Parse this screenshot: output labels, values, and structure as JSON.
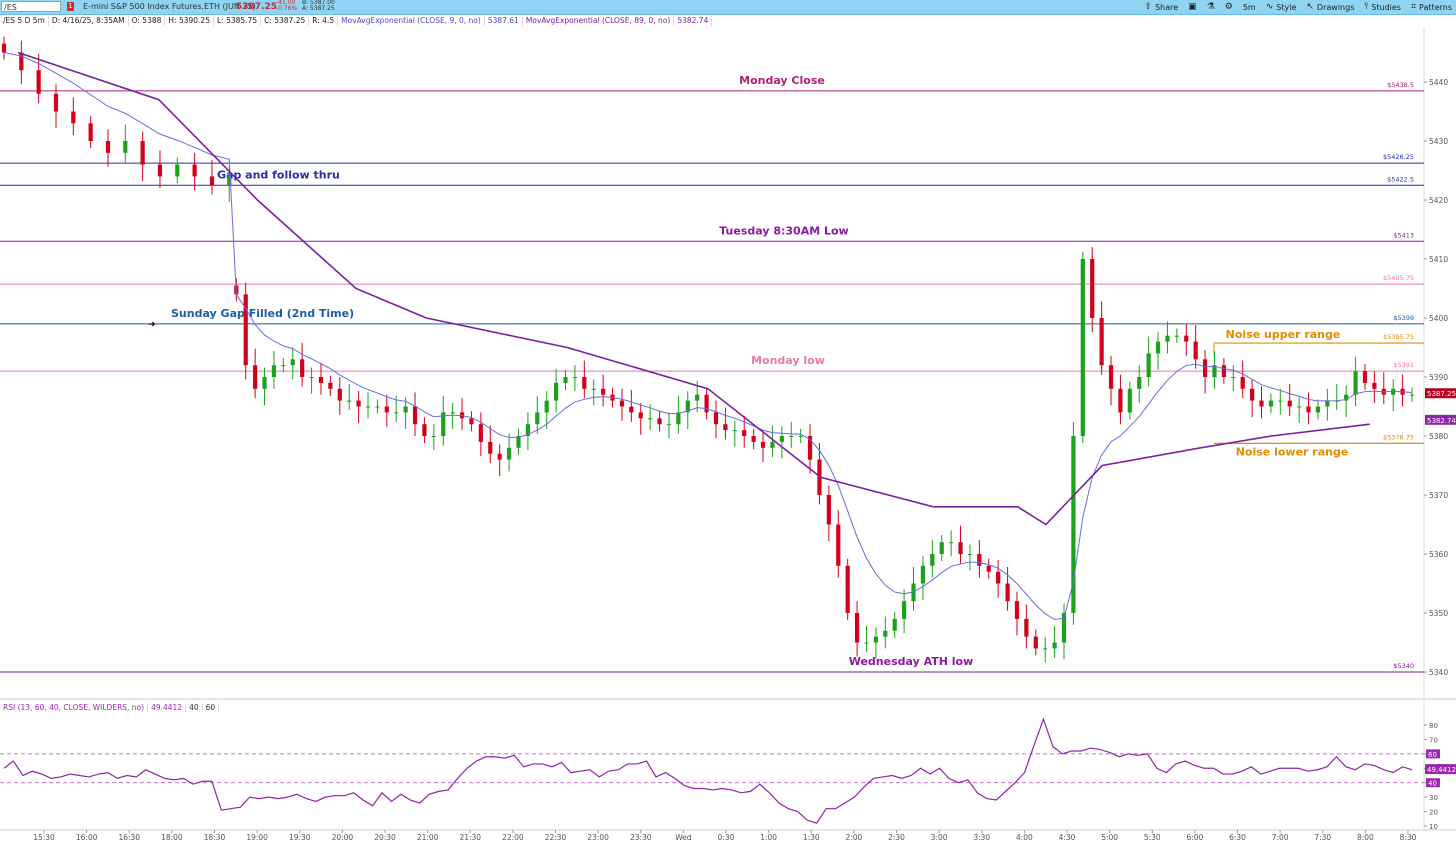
{
  "header": {
    "symbol": "/ES",
    "flag": "1",
    "description": "E-mini S&P 500 Index Futures,ETH (JUN 25)",
    "last": "5387.25",
    "change": "-41.00",
    "change_pct": "-0.76%",
    "bid": "B: 5387.00",
    "ask": "A: 5387.25"
  },
  "toolbar": [
    {
      "icon": "share-icon",
      "glyph": "⇪",
      "label": "Share"
    },
    {
      "icon": "camera-icon",
      "glyph": "▣",
      "label": ""
    },
    {
      "icon": "flask-icon",
      "glyph": "⚗",
      "label": ""
    },
    {
      "icon": "gear-icon",
      "glyph": "⚙",
      "label": ""
    },
    {
      "icon": "timeframe-icon",
      "glyph": "",
      "label": "5m"
    },
    {
      "icon": "style-icon",
      "glyph": "∿",
      "label": "Style"
    },
    {
      "icon": "drawings-icon",
      "glyph": "↖",
      "label": "Drawings"
    },
    {
      "icon": "studies-icon",
      "glyph": "⫯",
      "label": "Studies"
    },
    {
      "icon": "patterns-icon",
      "glyph": "⌗",
      "label": "Patterns"
    }
  ],
  "infobar": {
    "agg": "/ES 5 D 5m",
    "date": "D: 4/16/25, 8:35AM",
    "open": "O: 5388",
    "high": "H: 5390.25",
    "low": "L: 5385.75",
    "close": "C: 5387.25",
    "range": "R: 4.5",
    "ma9_label": "MovAvgExponential (CLOSE, 9, 0, no)",
    "ma9_value": "5387.61",
    "ma89_label": "MovAvgExponential (CLOSE, 89, 0, no)",
    "ma89_value": "5382.74"
  },
  "rsi_header": {
    "label": "RSI (13, 60, 40, CLOSE, WILDERS, no)",
    "value": "49.4412",
    "ob": "40",
    "os": "60"
  },
  "colors": {
    "up": "#1aa31a",
    "down": "#d4001a",
    "ema9": "#6a6ae0",
    "ema89": "#7b1fa2",
    "rsi": "#8e24aa",
    "grid": "#e8e8e8"
  },
  "chart_data": {
    "type": "candlestick",
    "price_axis": {
      "ticks": [
        5340,
        5350,
        5360,
        5370,
        5380,
        5390,
        5400,
        5410,
        5420,
        5430,
        5440
      ]
    },
    "time_axis": {
      "ticks": [
        "15:30",
        "16:00",
        "16:30",
        "18:00",
        "18:30",
        "19:00",
        "19:30",
        "20:00",
        "20:30",
        "21:00",
        "21:30",
        "22:00",
        "22:30",
        "23:00",
        "23:30",
        "Wed",
        "0:30",
        "1:00",
        "1:30",
        "2:00",
        "2:30",
        "3:00",
        "3:30",
        "4:00",
        "4:30",
        "5:00",
        "5:30",
        "6:00",
        "6:30",
        "7:00",
        "7:30",
        "8:00",
        "8:30"
      ]
    },
    "price_labels": {
      "last": "5387.25",
      "ema89": "5382.74"
    },
    "levels": [
      {
        "price": 5438.5,
        "label": "Monday Close",
        "tag": "$5438.5",
        "color": "#b0207a"
      },
      {
        "price": 5426.25,
        "label": "",
        "tag": "$5426.25",
        "color": "#2a2ab5"
      },
      {
        "price": 5422.5,
        "label": "Gap and follow thru",
        "tag": "$5422.5",
        "color": "#2a2ab5"
      },
      {
        "price": 5413,
        "label": "Tuesday 8:30AM Low",
        "tag": "$5413",
        "color": "#8a1aa0"
      },
      {
        "price": 5405.75,
        "label": "",
        "tag": "$5405.75",
        "color": "#e87aa8"
      },
      {
        "price": 5399,
        "label": "Sunday Gap Filled (2nd Time)",
        "tag": "$5399",
        "color": "#1a5ea8"
      },
      {
        "price": 5391,
        "label": "Monday low",
        "tag": "$5391",
        "color": "#e87aa8"
      },
      {
        "price": 5340,
        "label": "Wednesday ATH low",
        "tag": "$5340",
        "color": "#8a1aa0"
      }
    ],
    "noise_range": {
      "upper": {
        "price": 5395.75,
        "label": "Noise upper range",
        "tag": "$5395.75"
      },
      "lower": {
        "price": 5378.75,
        "label": "Noise lower range",
        "tag": "$5378.75"
      },
      "color": "#e68a00"
    },
    "segments": [
      {
        "x0": 0,
        "x1": 0.16,
        "v": [
          5445,
          5442,
          5438,
          5435,
          5433,
          5430,
          5428,
          5430,
          5426,
          5424,
          5426,
          5424,
          5422.5,
          5424
        ]
      },
      {
        "x0": 0.165,
        "x1": 1.0,
        "v": [
          5404,
          5392,
          5388,
          5390,
          5392,
          5392,
          5393,
          5390,
          5390,
          5389,
          5388,
          5386,
          5386,
          5385,
          5385,
          5385,
          5384,
          5384,
          5385,
          5382,
          5380,
          5380,
          5384,
          5384,
          5383,
          5382,
          5379,
          5377,
          5376,
          5378,
          5380,
          5382,
          5384,
          5386,
          5389,
          5390,
          5390,
          5388,
          5388,
          5387,
          5386,
          5385,
          5384,
          5383,
          5383,
          5382,
          5382,
          5384,
          5386,
          5387,
          5384,
          5382,
          5381,
          5381,
          5380,
          5379,
          5378,
          5379,
          5380,
          5380,
          5380,
          5376,
          5370,
          5365,
          5358,
          5350,
          5345,
          5345,
          5346,
          5347,
          5349,
          5352,
          5355,
          5358,
          5360,
          5362,
          5362,
          5360,
          5360,
          5358,
          5357,
          5355,
          5352,
          5349,
          5346,
          5344,
          5344,
          5345,
          5350,
          5380,
          5410,
          5400,
          5392,
          5388,
          5384,
          5388,
          5390,
          5394,
          5396,
          5397,
          5397,
          5396,
          5393,
          5390,
          5392,
          5390,
          5390,
          5388,
          5386,
          5385,
          5386,
          5386,
          5385,
          5385,
          5384,
          5385,
          5386,
          5386,
          5387,
          5391,
          5389,
          5388,
          5387,
          5388,
          5387,
          5387
        ]
      }
    ],
    "ema89_path": [
      [
        0.01,
        5445
      ],
      [
        0.11,
        5437
      ],
      [
        0.18,
        5420
      ],
      [
        0.25,
        5405
      ],
      [
        0.3,
        5400
      ],
      [
        0.4,
        5395
      ],
      [
        0.5,
        5388
      ],
      [
        0.58,
        5373
      ],
      [
        0.66,
        5368
      ],
      [
        0.72,
        5368
      ],
      [
        0.74,
        5365
      ],
      [
        0.78,
        5375
      ],
      [
        0.85,
        5378
      ],
      [
        0.9,
        5380
      ],
      [
        0.97,
        5382
      ]
    ],
    "rsi": {
      "range": [
        10,
        90
      ],
      "ticks": [
        10,
        20,
        30,
        40,
        50,
        60,
        70,
        80
      ],
      "levels": [
        60,
        40
      ],
      "values": [
        50,
        55,
        45,
        48,
        46,
        43,
        44,
        46,
        45,
        44,
        46,
        47,
        43,
        45,
        44,
        49,
        46,
        43,
        42,
        43,
        39,
        41,
        41,
        21,
        22,
        23,
        30,
        29,
        30,
        29,
        30,
        32,
        29,
        27,
        30,
        31,
        31,
        33,
        28,
        24,
        33,
        27,
        32,
        28,
        26,
        32,
        34,
        35,
        43,
        50,
        55,
        58,
        58,
        57,
        59,
        51,
        53,
        53,
        51,
        54,
        47,
        48,
        49,
        44,
        48,
        49,
        53,
        53,
        55,
        44,
        47,
        43,
        38,
        36,
        36,
        35,
        36,
        35,
        33,
        34,
        39,
        33,
        26,
        22,
        20,
        14,
        12,
        22,
        22,
        26,
        30,
        37,
        43,
        44,
        45,
        43,
        45,
        50,
        46,
        50,
        43,
        40,
        42,
        33,
        29,
        28,
        34,
        40,
        47,
        66,
        84,
        65,
        60,
        62,
        62,
        64,
        63,
        61,
        58,
        60,
        59,
        60,
        50,
        47,
        53,
        55,
        52,
        50,
        50,
        46,
        46,
        48,
        51,
        46,
        48,
        50,
        50,
        50,
        48,
        49,
        51,
        58,
        51,
        49,
        53,
        52,
        49,
        47,
        51,
        49
      ]
    }
  }
}
